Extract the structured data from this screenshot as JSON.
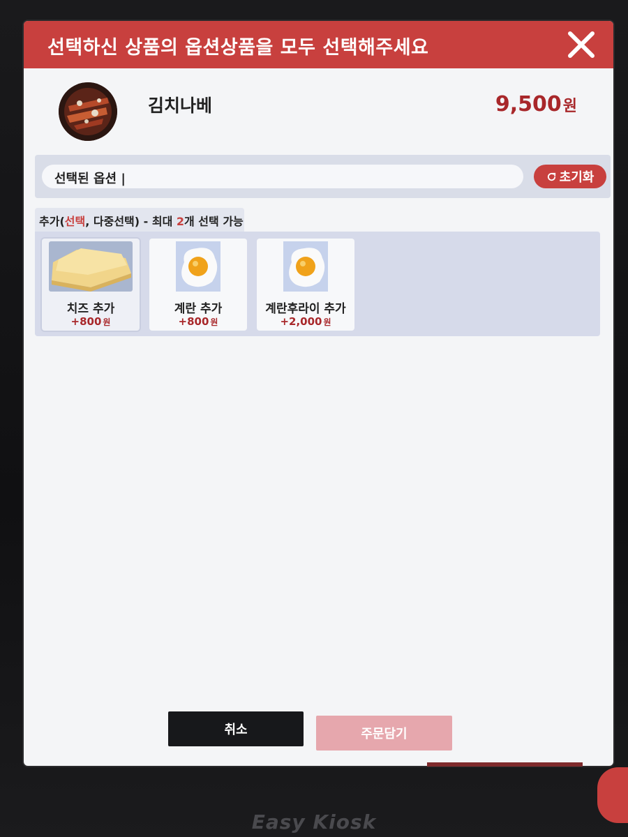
{
  "header": {
    "title": "선택하신 상품의 옵션상품을 모두 선택해주세요",
    "close_icon": "close-icon"
  },
  "product": {
    "name": "김치나베",
    "price": "9,500",
    "currency": "원"
  },
  "selected": {
    "label": "선택된 옵션 |",
    "reset_label": "초기화",
    "reset_icon": "refresh-icon"
  },
  "option_group": {
    "prefix": "추가(",
    "choice": "선택",
    "sep": ", ",
    "multi": "다중선택",
    "mid": ") - 최대 ",
    "max": "2",
    "suffix": "개 선택 가능"
  },
  "options": [
    {
      "name": "치즈 추가",
      "price": "+800",
      "currency": "원",
      "icon": "cheese-image",
      "selected": true
    },
    {
      "name": "계란 추가",
      "price": "+800",
      "currency": "원",
      "icon": "fried-egg-image",
      "selected": false
    },
    {
      "name": "계란후라이 추가",
      "price": "+2,000",
      "currency": "원",
      "icon": "fried-egg-image",
      "selected": false
    }
  ],
  "footer": {
    "cancel_label": "취소",
    "order_label": "주문담기"
  },
  "device": {
    "brand": "Easy Kiosk"
  },
  "colors": {
    "accent": "#c8403e",
    "price": "#a8272a",
    "order_disabled": "#e6a7ad"
  }
}
